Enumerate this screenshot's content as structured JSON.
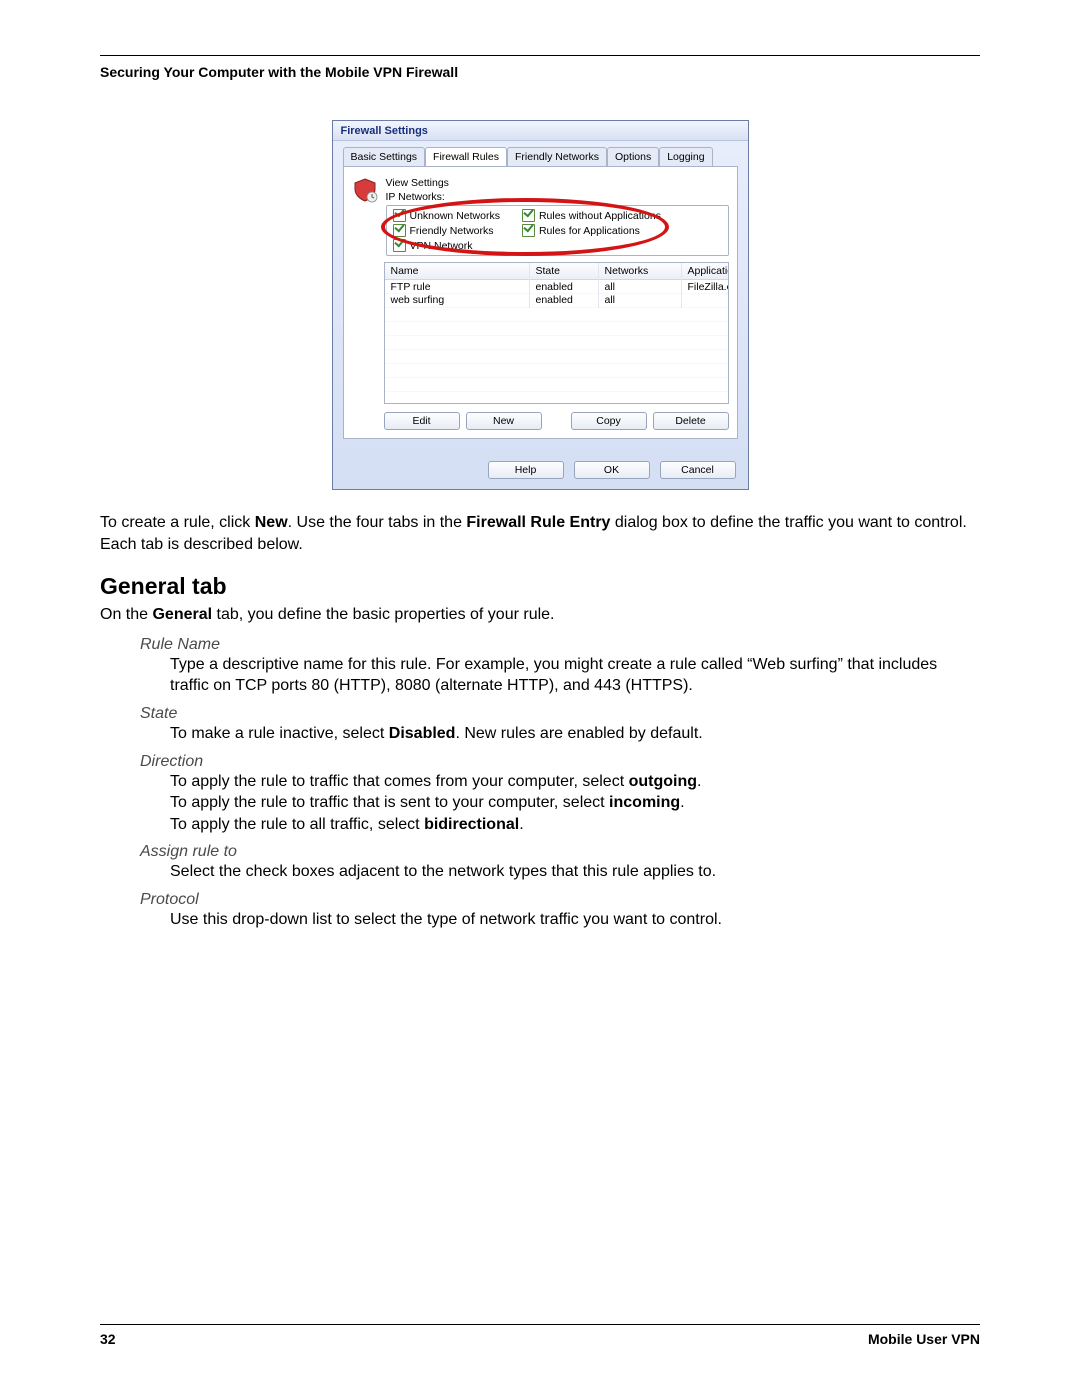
{
  "header": "Securing Your Computer with the Mobile VPN Firewall",
  "window": {
    "title": "Firewall Settings",
    "tabs": [
      "Basic Settings",
      "Firewall Rules",
      "Friendly Networks",
      "Options",
      "Logging"
    ],
    "active_tab_index": 1,
    "view_label": "View Settings",
    "ip_label": "IP Networks:",
    "left_checks": [
      "Unknown Networks",
      "Friendly Networks",
      "VPN Network"
    ],
    "right_checks": [
      "Rules without Applications",
      "Rules for Applications"
    ],
    "table": {
      "headers": [
        "Name",
        "State",
        "Networks",
        "Application"
      ],
      "rows": [
        {
          "name": "FTP rule",
          "state": "enabled",
          "networks": "all",
          "application": "FileZilla.exe"
        },
        {
          "name": "web surfing",
          "state": "enabled",
          "networks": "all",
          "application": ""
        }
      ]
    },
    "row_buttons": [
      "Edit",
      "New",
      "Copy",
      "Delete"
    ],
    "dialog_buttons": [
      "Help",
      "OK",
      "Cancel"
    ]
  },
  "intro": {
    "p1a": "To create a rule, click ",
    "b1": "New",
    "p1b": ". Use the four tabs in the ",
    "b2": "Firewall Rule Entry",
    "p1c": " dialog box to define the traffic you want to control. Each tab is described below."
  },
  "h2": "General tab",
  "general_intro_a": "On the ",
  "general_intro_b": "General",
  "general_intro_c": " tab, you define the basic properties of your rule.",
  "defs": {
    "rule_name": {
      "term": "Rule Name",
      "body": "Type a descriptive name for this rule. For example, you might create a rule called “Web surfing” that includes traffic on TCP ports 80 (HTTP), 8080 (alternate HTTP), and 443 (HTTPS)."
    },
    "state": {
      "term": "State",
      "body_a": "To make a rule inactive, select ",
      "body_b": "Disabled",
      "body_c": ". New rules are enabled by default."
    },
    "direction": {
      "term": "Direction",
      "l1a": "To apply the rule to traffic that comes from your computer, select ",
      "l1b": "outgoing",
      "l2a": "To apply the rule to traffic that is sent to your computer, select ",
      "l2b": "incoming",
      "l3a": "To apply the rule to all traffic, select ",
      "l3b": "bidirectional"
    },
    "assign": {
      "term": "Assign rule to",
      "body": "Select the check boxes adjacent to the network types that this rule applies to."
    },
    "protocol": {
      "term": "Protocol",
      "body": "Use this drop-down list to select the type of network traffic you want to control."
    }
  },
  "footer": {
    "page": "32",
    "product": "Mobile User VPN"
  }
}
